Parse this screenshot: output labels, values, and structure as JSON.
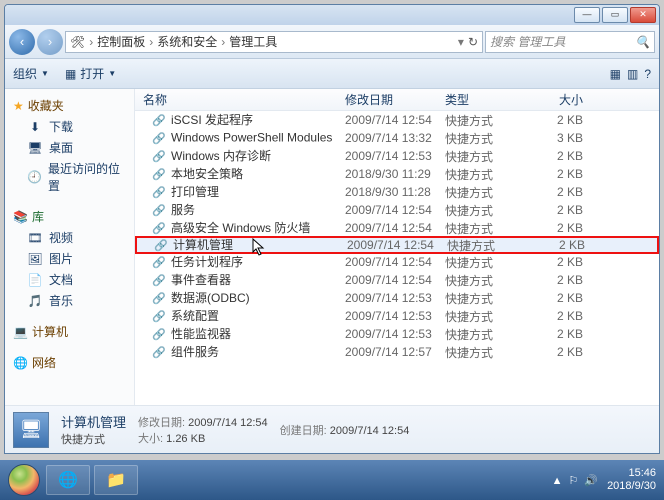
{
  "window_controls": {
    "min": "—",
    "max": "▭",
    "close": "✕"
  },
  "nav": {
    "back": "‹",
    "fwd": "›",
    "path": [
      "控制面板",
      "系统和安全",
      "管理工具"
    ],
    "refresh": "↻",
    "search_placeholder": "搜索 管理工具"
  },
  "toolbar": {
    "organize": "组织",
    "open": "打开",
    "view_icon": "▦",
    "help_icon": "?"
  },
  "tree": {
    "fav": "收藏夹",
    "fav_items": [
      {
        "icon": "⬇",
        "label": "下载"
      },
      {
        "icon": "🖥",
        "label": "桌面"
      },
      {
        "icon": "🕘",
        "label": "最近访问的位置"
      }
    ],
    "lib": "库",
    "lib_items": [
      {
        "icon": "🎞",
        "label": "视频"
      },
      {
        "icon": "🖼",
        "label": "图片"
      },
      {
        "icon": "📄",
        "label": "文档"
      },
      {
        "icon": "🎵",
        "label": "音乐"
      }
    ],
    "computer": "计算机",
    "network": "网络"
  },
  "columns": {
    "name": "名称",
    "date": "修改日期",
    "type": "类型",
    "size": "大小"
  },
  "rows": [
    {
      "icon": "🔗",
      "name": "iSCSI 发起程序",
      "date": "2009/7/14 12:54",
      "type": "快捷方式",
      "size": "2 KB",
      "hl": false
    },
    {
      "icon": "🔗",
      "name": "Windows PowerShell Modules",
      "date": "2009/7/14 13:32",
      "type": "快捷方式",
      "size": "3 KB",
      "hl": false
    },
    {
      "icon": "🔗",
      "name": "Windows 内存诊断",
      "date": "2009/7/14 12:53",
      "type": "快捷方式",
      "size": "2 KB",
      "hl": false
    },
    {
      "icon": "🔗",
      "name": "本地安全策略",
      "date": "2018/9/30 11:29",
      "type": "快捷方式",
      "size": "2 KB",
      "hl": false
    },
    {
      "icon": "🔗",
      "name": "打印管理",
      "date": "2018/9/30 11:28",
      "type": "快捷方式",
      "size": "2 KB",
      "hl": false
    },
    {
      "icon": "🔗",
      "name": "服务",
      "date": "2009/7/14 12:54",
      "type": "快捷方式",
      "size": "2 KB",
      "hl": false
    },
    {
      "icon": "🔗",
      "name": "高级安全 Windows 防火墙",
      "date": "2009/7/14 12:54",
      "type": "快捷方式",
      "size": "2 KB",
      "hl": false
    },
    {
      "icon": "🔗",
      "name": "计算机管理",
      "date": "2009/7/14 12:54",
      "type": "快捷方式",
      "size": "2 KB",
      "hl": true
    },
    {
      "icon": "🔗",
      "name": "任务计划程序",
      "date": "2009/7/14 12:54",
      "type": "快捷方式",
      "size": "2 KB",
      "hl": false
    },
    {
      "icon": "🔗",
      "name": "事件查看器",
      "date": "2009/7/14 12:54",
      "type": "快捷方式",
      "size": "2 KB",
      "hl": false
    },
    {
      "icon": "🔗",
      "name": "数据源(ODBC)",
      "date": "2009/7/14 12:53",
      "type": "快捷方式",
      "size": "2 KB",
      "hl": false
    },
    {
      "icon": "🔗",
      "name": "系统配置",
      "date": "2009/7/14 12:53",
      "type": "快捷方式",
      "size": "2 KB",
      "hl": false
    },
    {
      "icon": "🔗",
      "name": "性能监视器",
      "date": "2009/7/14 12:53",
      "type": "快捷方式",
      "size": "2 KB",
      "hl": false
    },
    {
      "icon": "🔗",
      "name": "组件服务",
      "date": "2009/7/14 12:57",
      "type": "快捷方式",
      "size": "2 KB",
      "hl": false
    }
  ],
  "details": {
    "filename": "计算机管理",
    "type_label": "快捷方式",
    "mod_label": "修改日期:",
    "mod_value": "2009/7/14 12:54",
    "size_label": "大小:",
    "size_value": "1.26 KB",
    "created_label": "创建日期:",
    "created_value": "2009/7/14 12:54"
  },
  "taskbar": {
    "tray_icons": [
      "▲",
      "⚐",
      "🔊"
    ],
    "time": "15:46",
    "date": "2018/9/30"
  }
}
